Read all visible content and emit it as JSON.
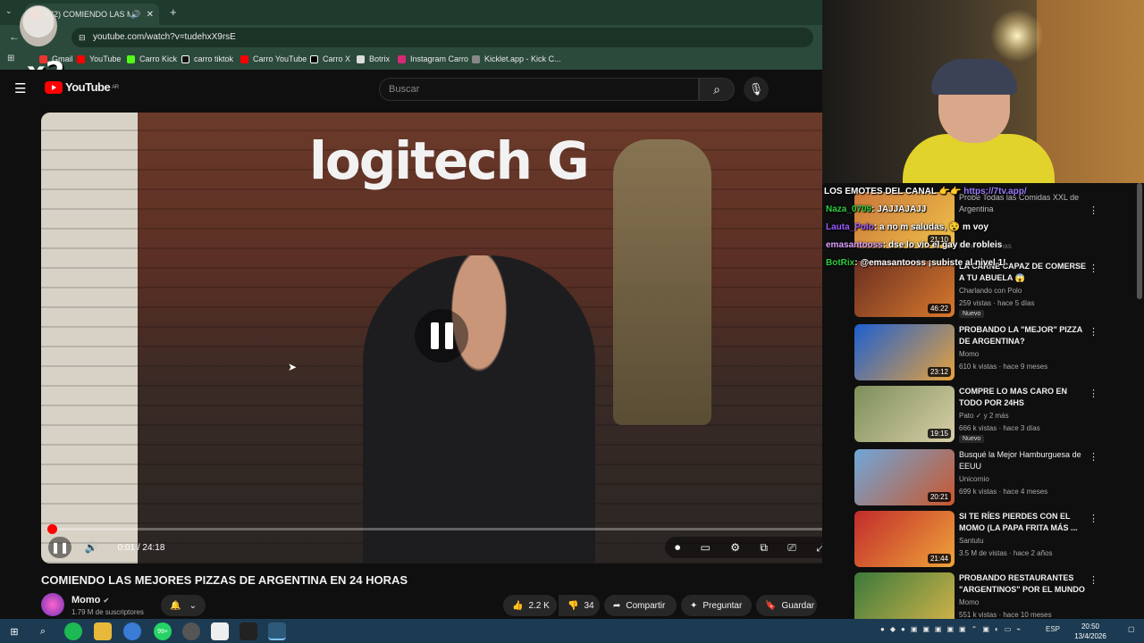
{
  "browser": {
    "tab_title": "(72) COMIENDO LAS MEJO",
    "url": "youtube.com/watch?v=tudehxX9rsE",
    "bookmarks": [
      "Gmail",
      "YouTube",
      "Carro Kick",
      "carro tiktok",
      "Carro YouTube",
      "Carro X",
      "Botrix",
      "Instagram Carro",
      "Kicklet.app - Kick C..."
    ]
  },
  "overlay": {
    "multiplier": "x2"
  },
  "youtube": {
    "logo_text": "YouTube",
    "logo_region": "AR",
    "search_placeholder": "Buscar"
  },
  "player": {
    "banner_text": "logitech G",
    "current_time": "0:01",
    "total_time": "24:18",
    "time_display": "0:01 / 24:18",
    "progress": 0.0007
  },
  "video": {
    "title": "COMIENDO LAS MEJORES PIZZAS DE ARGENTINA EN 24 HORAS",
    "channel": "Momo",
    "subscribers": "1.79 M de suscriptores",
    "likes": "2.2 K",
    "dislikes": "34",
    "share_label": "Compartir",
    "ask_label": "Preguntar",
    "save_label": "Guardar"
  },
  "chat": [
    {
      "user": "LOS EMOTES DEL CANAL",
      "text": "👉👉 https://7tv.app/",
      "color": "#ffffff",
      "link_color": "#9b7bff"
    },
    {
      "user": "Naza_0709",
      "text": ": JAJJAJAJJ",
      "color": "#2ecc40"
    },
    {
      "user": "Lauta_Polo",
      "text": ": a no m saludas, 😵 m voy",
      "color": "#9b59ff"
    },
    {
      "user": "emasantooss",
      "text": ": dse lo vio el gay de robleis",
      "color": "#e0a3ff"
    },
    {
      "user": "BotRix",
      "text": ": @emasantooss ¡subiste al nivel 1!",
      "color": "#2ecc40",
      "mention_color": "#6fa8ff"
    }
  ],
  "recommendations": [
    {
      "title": "Probé Todas las Comidas XXL de Argentina",
      "channel": "",
      "stats": "hace 2 semanas",
      "duration": "21:10",
      "badge": ""
    },
    {
      "title": "LA CARNE CAPAZ DE COMERSE A TU ABUELA 😱",
      "channel": "Charlando con Polo",
      "stats": "259 vistas · hace 5 días",
      "duration": "46:22",
      "badge": "Nuevo"
    },
    {
      "title": "PROBANDO LA \"MEJOR\" PIZZA DE ARGENTINA?",
      "channel": "Momo",
      "stats": "610 k vistas · hace 9 meses",
      "duration": "23:12",
      "badge": ""
    },
    {
      "title": "COMPRE LO MAS CARO EN TODO POR 24HS",
      "channel": "Pato ✓ y 2 más",
      "stats": "666 k vistas · hace 3 días",
      "duration": "19:15",
      "badge": "Nuevo"
    },
    {
      "title": "Busqué la Mejor Hamburguesa de EEUU",
      "channel": "Unicornio",
      "stats": "699 k vistas · hace 4 meses",
      "duration": "20:21",
      "badge": ""
    },
    {
      "title": "SI TE RÍES PIERDES CON EL MOMO (LA PAPA FRITA MÁS ...",
      "channel": "Santutu",
      "stats": "3.5 M de vistas · hace 2 años",
      "duration": "21:44",
      "badge": ""
    },
    {
      "title": "PROBANDO RESTAURANTES \"ARGENTINOS\" POR EL MUNDO",
      "channel": "Momo",
      "stats": "551 k vistas · hace 10 meses",
      "duration": "",
      "badge": ""
    }
  ],
  "taskbar": {
    "language": "ESP",
    "time": "20:50",
    "date": "13/4/2026",
    "whatsapp_badge": "99+"
  },
  "colors": {
    "accent": "#ff0000",
    "chrome": "#2b4a3c",
    "taskbar": "#1c3b52"
  }
}
